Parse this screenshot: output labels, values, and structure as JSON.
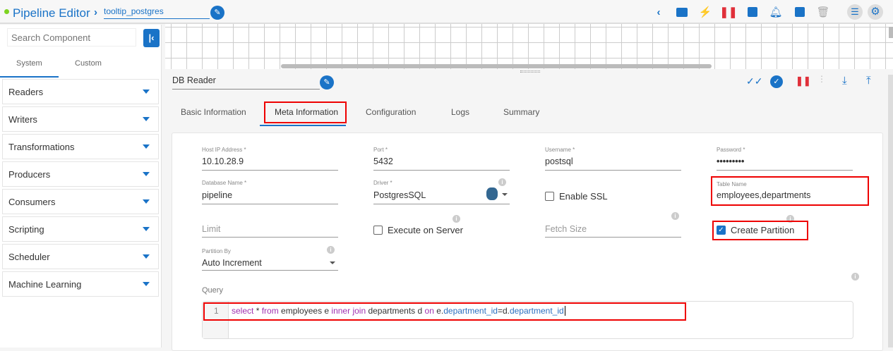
{
  "header": {
    "title": "Pipeline Editor",
    "pipeline_name": "tooltip_postgres",
    "status_color": "#7ed321"
  },
  "toolbar_icons": [
    "chevron-left-icon",
    "comment-icon",
    "bolt-icon",
    "pause-icon",
    "save-icon",
    "bell-alert-icon",
    "chart-icon",
    "trash-icon",
    "list-icon",
    "gear-icon"
  ],
  "sidebar": {
    "search_placeholder": "Search Component",
    "tabs": [
      "System",
      "Custom"
    ],
    "categories": [
      "Readers",
      "Writers",
      "Transformations",
      "Producers",
      "Consumers",
      "Scripting",
      "Scheduler",
      "Machine Learning"
    ]
  },
  "panel": {
    "component_name": "DB Reader",
    "tabs": [
      "Basic Information",
      "Meta Information",
      "Configuration",
      "Logs",
      "Summary"
    ],
    "active_tab": "Meta Information"
  },
  "form": {
    "host": {
      "label": "Host IP Address *",
      "value": "10.10.28.9"
    },
    "port": {
      "label": "Port *",
      "value": "5432"
    },
    "username": {
      "label": "Username *",
      "value": "postsql"
    },
    "password": {
      "label": "Password *",
      "value": "•••••••••"
    },
    "database": {
      "label": "Database Name *",
      "value": "pipeline"
    },
    "driver": {
      "label": "Driver *",
      "value": "PostgresSQL"
    },
    "ssl": {
      "label": "Enable SSL",
      "checked": false
    },
    "table": {
      "label": "Table Name",
      "value": "employees,departments"
    },
    "limit": {
      "placeholder": "Limit"
    },
    "execute": {
      "label": "Execute on Server",
      "checked": false
    },
    "fetch": {
      "placeholder": "Fetch Size"
    },
    "partition": {
      "label": "Create Partition",
      "checked": true
    },
    "partition_by": {
      "label": "Partition By",
      "value": "Auto Increment"
    },
    "query": {
      "label": "Query",
      "line": "1",
      "tokens": [
        {
          "t": "select",
          "c": "kw"
        },
        {
          "t": " * ",
          "c": "tx"
        },
        {
          "t": "from",
          "c": "kw"
        },
        {
          "t": " employees e ",
          "c": "tx"
        },
        {
          "t": "inner join",
          "c": "kw"
        },
        {
          "t": " departments d ",
          "c": "tx"
        },
        {
          "t": "on",
          "c": "kw"
        },
        {
          "t": " e.",
          "c": "tx"
        },
        {
          "t": "department_id",
          "c": "id"
        },
        {
          "t": "=d.",
          "c": "tx"
        },
        {
          "t": "department_id",
          "c": "id"
        }
      ]
    }
  }
}
